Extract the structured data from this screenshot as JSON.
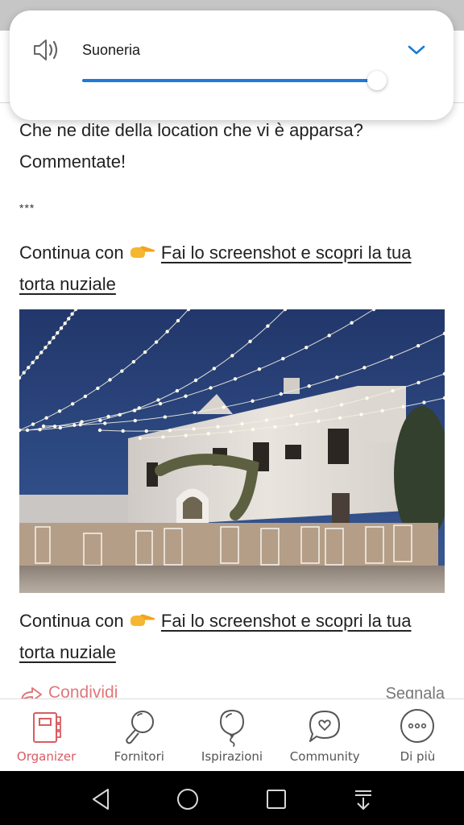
{
  "volume_panel": {
    "stream_label": "Suoneria",
    "level_percent": 100,
    "icons": {
      "speaker": "speaker-volume-icon",
      "expand": "chevron-down-icon"
    },
    "accent_color": "#1e7ad6"
  },
  "post": {
    "question_line": "Che ne dite della location che vi è apparsa? Commentate!",
    "separator": "***",
    "continue_prefix": "Continua con",
    "continue_emoji": "👉",
    "continue_link": "Fai lo screenshot e scopri la tua torta nuziale",
    "image_alt": "Masseria bianca illuminata da luci a festoni con tavoli e sedie per ricevimento di nozze",
    "continue2_prefix": "Continua con",
    "continue2_link": "Fai lo screenshot e scopri la tua torta nuziale",
    "share_label": "Condividi",
    "report_label": "Segnala"
  },
  "tabbar": {
    "items": [
      {
        "label": "Organizer",
        "icon": "organizer-notebook-icon",
        "active": true
      },
      {
        "label": "Fornitori",
        "icon": "search-icon",
        "active": false
      },
      {
        "label": "Ispirazioni",
        "icon": "balloon-icon",
        "active": false
      },
      {
        "label": "Community",
        "icon": "chat-heart-icon",
        "active": false
      },
      {
        "label": "Di più",
        "icon": "more-dots-icon",
        "active": false
      }
    ],
    "active_color": "#d85c62"
  },
  "navbar": {
    "buttons": [
      "back-icon",
      "home-icon",
      "recents-icon",
      "notification-pulldown-icon"
    ]
  }
}
